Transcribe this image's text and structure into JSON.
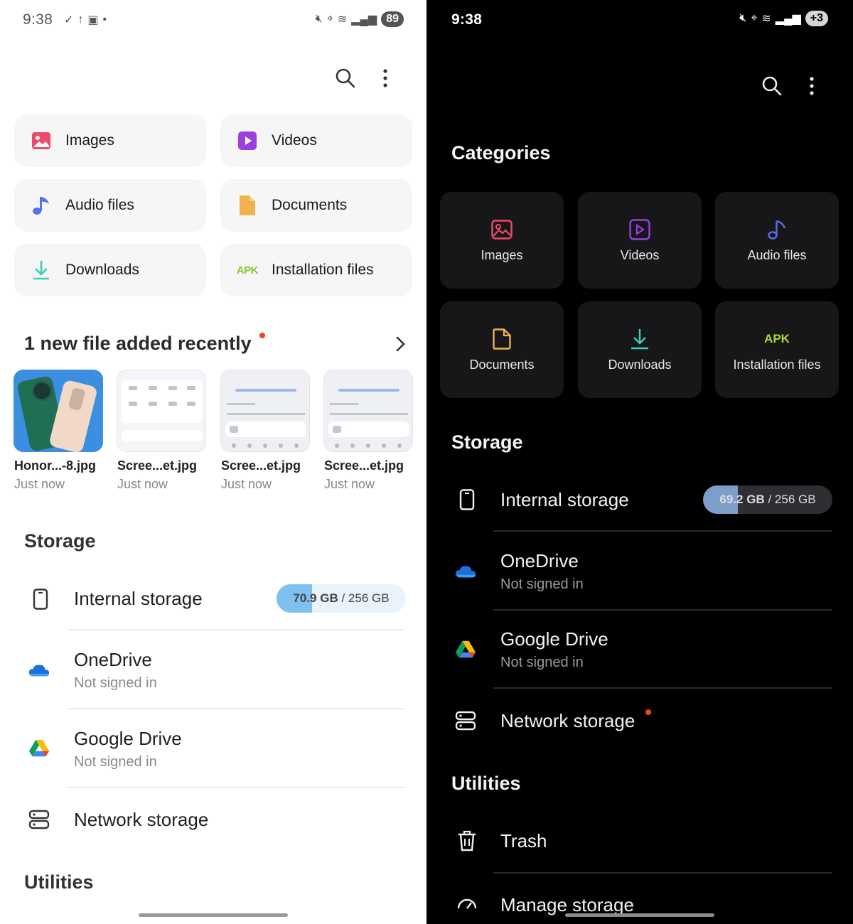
{
  "light": {
    "status": {
      "time": "9:38",
      "battery": "89"
    },
    "categories": [
      {
        "label": "Images",
        "icon": "image-icon",
        "color": "#f0496b"
      },
      {
        "label": "Videos",
        "icon": "video-icon",
        "color": "#9b3fe0"
      },
      {
        "label": "Audio files",
        "icon": "music-note-icon",
        "color": "#5a6ef0"
      },
      {
        "label": "Documents",
        "icon": "document-icon",
        "color": "#f1b14f"
      },
      {
        "label": "Downloads",
        "icon": "download-icon",
        "color": "#3ccfb5"
      },
      {
        "label": "Installation files",
        "icon": "apk-icon",
        "color": "#86c92b",
        "badge": "APK"
      }
    ],
    "recent": {
      "title": "1 new file added recently",
      "files": [
        {
          "name": "Honor...-8.jpg",
          "time": "Just now"
        },
        {
          "name": "Scree...et.jpg",
          "time": "Just now"
        },
        {
          "name": "Scree...et.jpg",
          "time": "Just now"
        },
        {
          "name": "Scree...et.jpg",
          "time": "Just now"
        }
      ]
    },
    "storage": {
      "title": "Storage",
      "internal": {
        "label": "Internal storage",
        "used": "70.9 GB",
        "total": "/ 256 GB",
        "fraction": 0.277
      },
      "onedrive": {
        "label": "OneDrive",
        "sub": "Not signed in"
      },
      "gdrive": {
        "label": "Google Drive",
        "sub": "Not signed in"
      },
      "network": {
        "label": "Network storage"
      }
    },
    "utilities": {
      "title": "Utilities"
    }
  },
  "dark": {
    "status": {
      "time": "9:38",
      "battery": "+3"
    },
    "categories_title": "Categories",
    "categories": [
      {
        "label": "Images",
        "icon": "image-icon",
        "color": "#f0496b"
      },
      {
        "label": "Videos",
        "icon": "video-icon",
        "color": "#9b3fe0"
      },
      {
        "label": "Audio files",
        "icon": "music-note-icon",
        "color": "#5a6ef0"
      },
      {
        "label": "Documents",
        "icon": "document-icon",
        "color": "#f1b14f"
      },
      {
        "label": "Downloads",
        "icon": "download-icon",
        "color": "#3ccfb5"
      },
      {
        "label": "Installation files",
        "icon": "apk-icon",
        "color": "#a6e02b",
        "badge": "APK"
      }
    ],
    "storage": {
      "title": "Storage",
      "internal": {
        "label": "Internal storage",
        "used": "69.2 GB",
        "total": "/ 256 GB",
        "fraction": 0.27
      },
      "onedrive": {
        "label": "OneDrive",
        "sub": "Not signed in"
      },
      "gdrive": {
        "label": "Google Drive",
        "sub": "Not signed in"
      },
      "network": {
        "label": "Network storage"
      }
    },
    "utilities": {
      "title": "Utilities",
      "trash": {
        "label": "Trash"
      },
      "manage": {
        "label": "Manage storage"
      }
    }
  }
}
